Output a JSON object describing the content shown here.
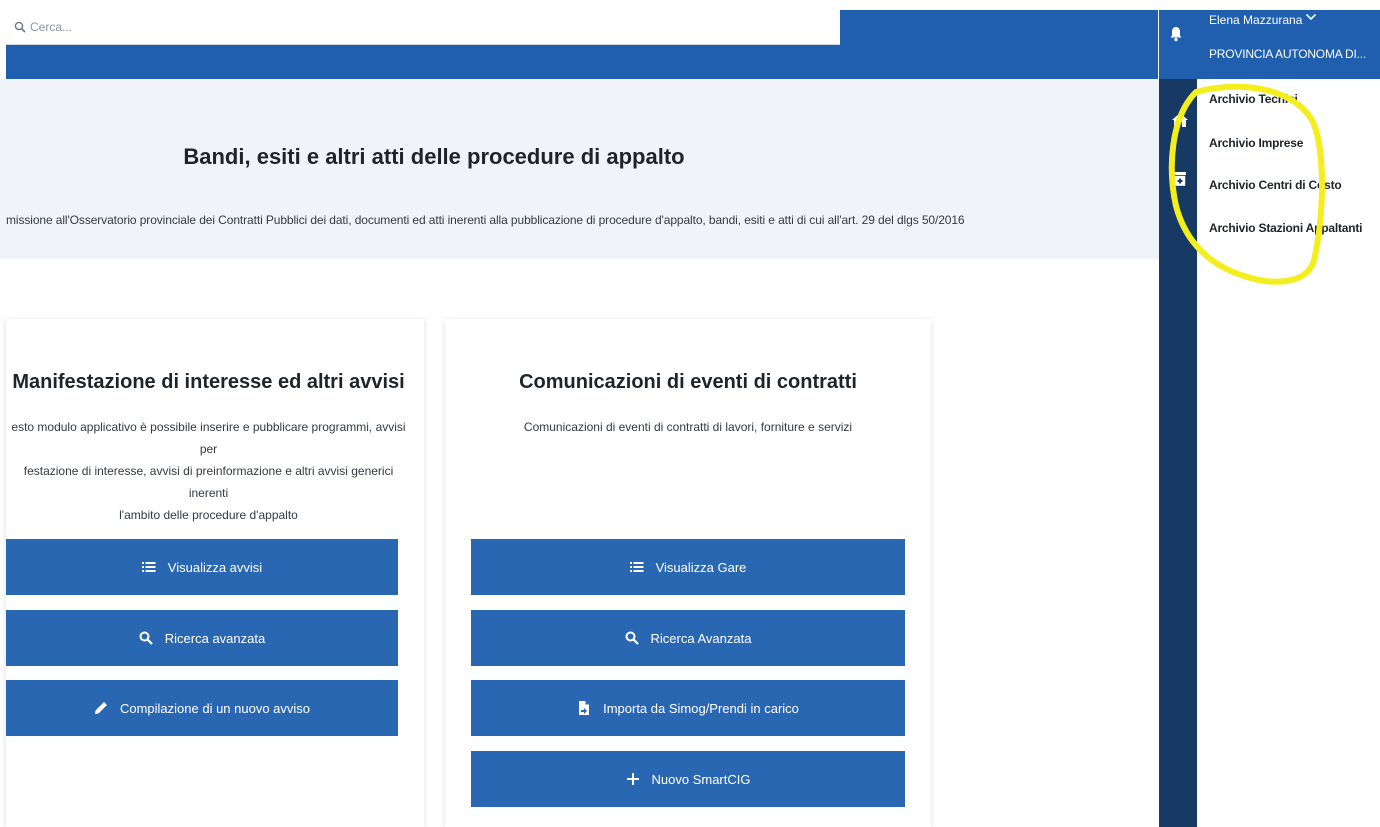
{
  "search": {
    "placeholder": "Cerca..."
  },
  "user": {
    "name": "Elena Mazzurana",
    "org": "PROVINCIA AUTONOMA DI..."
  },
  "archive_menu": {
    "items": [
      {
        "label": "Archivio Tecnici"
      },
      {
        "label": "Archivio Imprese"
      },
      {
        "label": "Archivio Centri di Costo"
      },
      {
        "label": "Archivio Stazioni Appaltanti"
      }
    ]
  },
  "hero": {
    "title": "Bandi, esiti e altri atti delle procedure di appalto",
    "subtitle": "missione all'Osservatorio provinciale dei Contratti Pubblici dei dati, documenti ed atti inerenti alla pubblicazione di procedure d'appalto, bandi, esiti e atti di cui all'art. 29 del dlgs 50/2016"
  },
  "cards": [
    {
      "title": "Manifestazione di interesse ed altri avvisi",
      "desc_lines": [
        "esto modulo applicativo è possibile inserire e pubblicare programmi, avvisi per",
        "festazione di interesse, avvisi di preinformazione e altri avvisi generici inerenti",
        "l'ambito delle procedure d'appalto"
      ],
      "buttons": [
        {
          "label": "Visualizza avvisi",
          "icon": "list-icon"
        },
        {
          "label": "Ricerca avanzata",
          "icon": "search-icon"
        },
        {
          "label": "Compilazione di un nuovo avviso",
          "icon": "pencil-icon"
        }
      ]
    },
    {
      "title": "Comunicazioni di eventi di contratti",
      "desc_lines": [
        "Comunicazioni di eventi di contratti di lavori, forniture e servizi"
      ],
      "buttons": [
        {
          "label": "Visualizza Gare",
          "icon": "list-icon"
        },
        {
          "label": "Ricerca Avanzata",
          "icon": "search-icon"
        },
        {
          "label": "Importa da Simog/Prendi in carico",
          "icon": "file-import-icon"
        },
        {
          "label": "Nuovo SmartCIG",
          "icon": "plus-icon"
        }
      ]
    }
  ],
  "colors": {
    "header_blue": "#1f5fae",
    "button_blue": "#2a67b3",
    "sidebar_dark": "#163a64",
    "highlight_yellow": "#f4ee1f",
    "hero_bg": "#f0f4f8"
  }
}
